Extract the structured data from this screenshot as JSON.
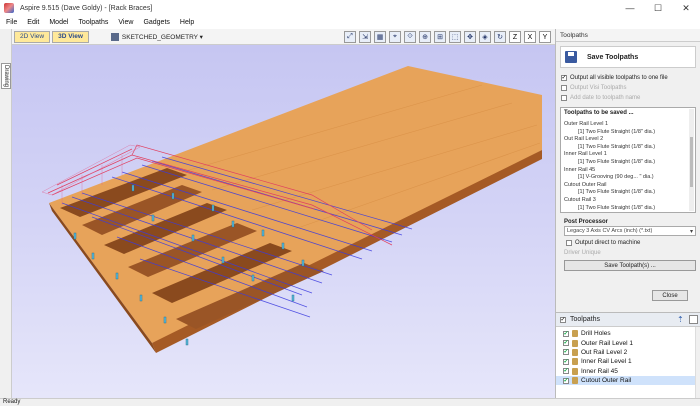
{
  "window": {
    "title": "Aspire 9.515 (Dave Goldy) - [Rack Braces]",
    "minimize": "—",
    "maximize": "☐",
    "close": "✕"
  },
  "menu": [
    "File",
    "Edit",
    "Model",
    "Toolpaths",
    "View",
    "Gadgets",
    "Help"
  ],
  "side_tab": {
    "label": "Drawing"
  },
  "view_tabs": {
    "view2d": "2D View",
    "view3d": "3D View"
  },
  "geometry_select": "SKETCHED_GEOMETRY ▾",
  "toolbar_icons": [
    "fit-icon",
    "resize-icon",
    "grid-icon",
    "cursor-icon",
    "measure-icon",
    "zoom-icon",
    "zoom-box-icon",
    "select-icon",
    "pan-icon",
    "iso-icon",
    "rotate-icon",
    "z-icon",
    "x-icon",
    "y-icon"
  ],
  "panel": {
    "header": "Toolpaths",
    "save_title": "Save Toolpaths",
    "opt_all_visible": "Output all visible toolpaths to one file",
    "opt_visible_toolpaths": "Output Visi Toolpaths",
    "opt_add_date": "Add date to toolpath name",
    "saved_title": "Toolpaths to be saved ...",
    "saved_lines": [
      {
        "text": "Outer Rail Level 1",
        "sub": false
      },
      {
        "text": "[1] Two Flute Straight (1/8\" dia.)",
        "sub": true
      },
      {
        "text": "Out Rail Level 2",
        "sub": false
      },
      {
        "text": "[1] Two Flute Straight (1/8\" dia.)",
        "sub": true
      },
      {
        "text": "Inner Rail Level 1",
        "sub": false
      },
      {
        "text": "[1] Two Flute Straight (1/8\" dia.)",
        "sub": true
      },
      {
        "text": "Inner Rail 45",
        "sub": false
      },
      {
        "text": "[1] V-Grooving (90 deg... \" dia.)",
        "sub": true
      },
      {
        "text": "Cutout Outer Rail",
        "sub": false
      },
      {
        "text": "[1] Two Flute Straight (1/8\" dia.)",
        "sub": true
      },
      {
        "text": "Cutout Rail 3",
        "sub": false
      },
      {
        "text": "[1] Two Flute Straight (1/8\" dia.)",
        "sub": true
      }
    ],
    "post_processor_title": "Post Processor",
    "post_processor_value": "Legacy 3 Axis CV Arcs (inch) (*.txt)",
    "output_direct": "Output direct to machine",
    "driver_label": "Driver Unique",
    "save_button": "Save Toolpath(s) ...",
    "close_button": "Close"
  },
  "toolpath_list": {
    "header": "Toolpaths",
    "items": [
      {
        "name": "Drill Holes",
        "selected": false
      },
      {
        "name": "Outer Rail Level 1",
        "selected": false
      },
      {
        "name": "Out Rail Level 2",
        "selected": false
      },
      {
        "name": "Inner Rail Level 1",
        "selected": false
      },
      {
        "name": "Inner Rail 45",
        "selected": false
      },
      {
        "name": "Cutout Outer Rail",
        "selected": true
      }
    ]
  },
  "status": "Ready",
  "colors": {
    "viewport_bg": "#cfcff5",
    "wood_light": "#e8a258",
    "wood_dark": "#b5632a",
    "toolpath_blue": "#3a3adf",
    "toolpath_red": "#e04060",
    "tool_cyan": "#5ab8d8",
    "selection": "#cfe2fb"
  }
}
